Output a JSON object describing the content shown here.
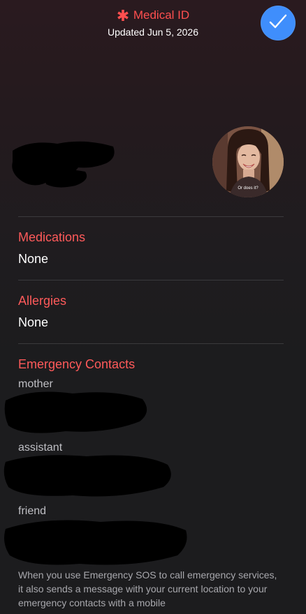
{
  "header": {
    "title": "Medical ID",
    "updated": "Updated Jun 5, 2026",
    "asterisk_icon": "medical-asterisk-icon",
    "accent_color": "#ff4f4f"
  },
  "done_button": {
    "icon": "checkmark-icon",
    "color": "#3f8efc"
  },
  "avatar": {
    "caption": "Or does it?"
  },
  "sections": {
    "medications": {
      "label": "Medications",
      "value": "None"
    },
    "allergies": {
      "label": "Allergies",
      "value": "None"
    },
    "emergency_contacts": {
      "label": "Emergency Contacts",
      "contacts": [
        {
          "relation": "mother"
        },
        {
          "relation": "assistant"
        },
        {
          "relation": "friend"
        }
      ]
    }
  },
  "footer": {
    "text": "When you use Emergency SOS to call emergency services, it also sends a message with your current location to your emergency contacts with a mobile"
  }
}
